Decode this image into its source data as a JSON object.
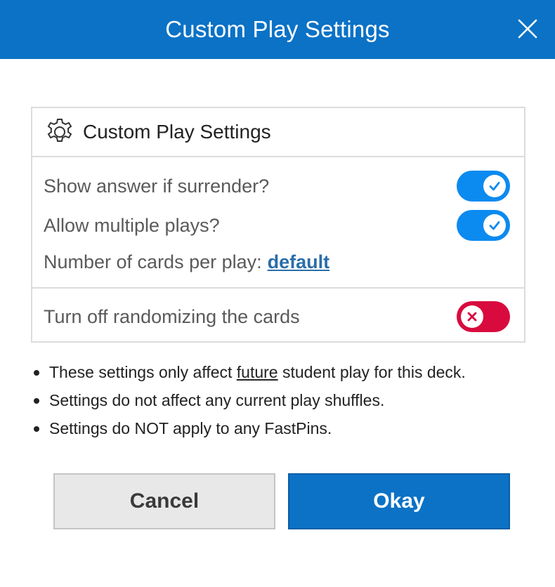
{
  "header": {
    "title": "Custom Play Settings"
  },
  "panel": {
    "title": "Custom Play Settings",
    "settings": [
      {
        "label": "Show answer if surrender?",
        "state": "on"
      },
      {
        "label": "Allow multiple plays?",
        "state": "on"
      }
    ],
    "cards_per_play": {
      "label": "Number of cards per play:",
      "value": "default"
    },
    "randomize": {
      "label": "Turn off randomizing the cards",
      "state": "off"
    }
  },
  "notes": [
    {
      "before": "These settings only affect ",
      "emph": "future",
      "after": " student play for this deck."
    },
    {
      "text": "Settings do not affect any current play shuffles."
    },
    {
      "text": "Settings do NOT apply to any FastPins."
    }
  ],
  "buttons": {
    "cancel": "Cancel",
    "okay": "Okay"
  },
  "colors": {
    "accent": "#0b72c6",
    "toggle_on": "#0b8af0",
    "toggle_off": "#d90b3e",
    "link": "#2a6ea8"
  }
}
